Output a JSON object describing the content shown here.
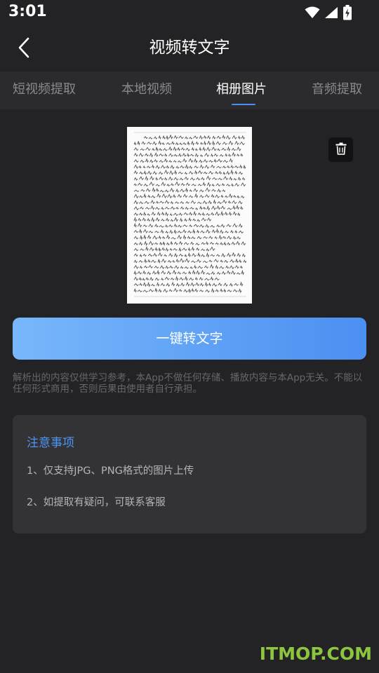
{
  "status_bar": {
    "time": "3:01",
    "icons": [
      "wifi-icon",
      "signal-icon",
      "battery-charging-icon"
    ]
  },
  "header": {
    "title": "视频转文字",
    "back_icon": "chevron-left-icon"
  },
  "tabs": [
    {
      "label": "短视频提取",
      "active": false
    },
    {
      "label": "本地视频",
      "active": false
    },
    {
      "label": "相册图片",
      "active": true
    },
    {
      "label": "音频提取",
      "active": false
    }
  ],
  "preview": {
    "delete_icon": "trash-icon"
  },
  "convert_button_label": "一键转文字",
  "disclaimer": "解析出的内容仅供学习参考，本App不做任何存储、播放内容与本App无关。不能以任何形式商用，否则后果由使用者自行承担。",
  "notice": {
    "title": "注意事项",
    "items": [
      "1、仅支持JPG、PNG格式的图片上传",
      "2、如提取有疑问，可联系客服"
    ]
  },
  "watermark": "ITMOP.COM",
  "colors": {
    "background": "#232325",
    "tab_bar": "#2b2b2d",
    "accent": "#4d8ff0",
    "button_gradient_start": "#78b7fb",
    "button_gradient_end": "#4b8ff1",
    "card": "#333336",
    "watermark": "#8cc63f"
  }
}
